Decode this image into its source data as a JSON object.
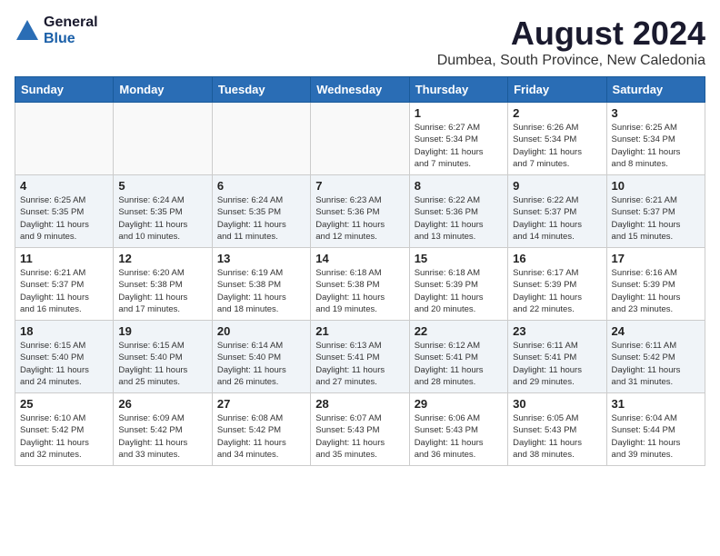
{
  "logo": {
    "general": "General",
    "blue": "Blue"
  },
  "header": {
    "month": "August 2024",
    "location": "Dumbea, South Province, New Caledonia"
  },
  "weekdays": [
    "Sunday",
    "Monday",
    "Tuesday",
    "Wednesday",
    "Thursday",
    "Friday",
    "Saturday"
  ],
  "weeks": [
    [
      {
        "day": "",
        "info": ""
      },
      {
        "day": "",
        "info": ""
      },
      {
        "day": "",
        "info": ""
      },
      {
        "day": "",
        "info": ""
      },
      {
        "day": "1",
        "info": "Sunrise: 6:27 AM\nSunset: 5:34 PM\nDaylight: 11 hours\nand 7 minutes."
      },
      {
        "day": "2",
        "info": "Sunrise: 6:26 AM\nSunset: 5:34 PM\nDaylight: 11 hours\nand 7 minutes."
      },
      {
        "day": "3",
        "info": "Sunrise: 6:25 AM\nSunset: 5:34 PM\nDaylight: 11 hours\nand 8 minutes."
      }
    ],
    [
      {
        "day": "4",
        "info": "Sunrise: 6:25 AM\nSunset: 5:35 PM\nDaylight: 11 hours\nand 9 minutes."
      },
      {
        "day": "5",
        "info": "Sunrise: 6:24 AM\nSunset: 5:35 PM\nDaylight: 11 hours\nand 10 minutes."
      },
      {
        "day": "6",
        "info": "Sunrise: 6:24 AM\nSunset: 5:35 PM\nDaylight: 11 hours\nand 11 minutes."
      },
      {
        "day": "7",
        "info": "Sunrise: 6:23 AM\nSunset: 5:36 PM\nDaylight: 11 hours\nand 12 minutes."
      },
      {
        "day": "8",
        "info": "Sunrise: 6:22 AM\nSunset: 5:36 PM\nDaylight: 11 hours\nand 13 minutes."
      },
      {
        "day": "9",
        "info": "Sunrise: 6:22 AM\nSunset: 5:37 PM\nDaylight: 11 hours\nand 14 minutes."
      },
      {
        "day": "10",
        "info": "Sunrise: 6:21 AM\nSunset: 5:37 PM\nDaylight: 11 hours\nand 15 minutes."
      }
    ],
    [
      {
        "day": "11",
        "info": "Sunrise: 6:21 AM\nSunset: 5:37 PM\nDaylight: 11 hours\nand 16 minutes."
      },
      {
        "day": "12",
        "info": "Sunrise: 6:20 AM\nSunset: 5:38 PM\nDaylight: 11 hours\nand 17 minutes."
      },
      {
        "day": "13",
        "info": "Sunrise: 6:19 AM\nSunset: 5:38 PM\nDaylight: 11 hours\nand 18 minutes."
      },
      {
        "day": "14",
        "info": "Sunrise: 6:18 AM\nSunset: 5:38 PM\nDaylight: 11 hours\nand 19 minutes."
      },
      {
        "day": "15",
        "info": "Sunrise: 6:18 AM\nSunset: 5:39 PM\nDaylight: 11 hours\nand 20 minutes."
      },
      {
        "day": "16",
        "info": "Sunrise: 6:17 AM\nSunset: 5:39 PM\nDaylight: 11 hours\nand 22 minutes."
      },
      {
        "day": "17",
        "info": "Sunrise: 6:16 AM\nSunset: 5:39 PM\nDaylight: 11 hours\nand 23 minutes."
      }
    ],
    [
      {
        "day": "18",
        "info": "Sunrise: 6:15 AM\nSunset: 5:40 PM\nDaylight: 11 hours\nand 24 minutes."
      },
      {
        "day": "19",
        "info": "Sunrise: 6:15 AM\nSunset: 5:40 PM\nDaylight: 11 hours\nand 25 minutes."
      },
      {
        "day": "20",
        "info": "Sunrise: 6:14 AM\nSunset: 5:40 PM\nDaylight: 11 hours\nand 26 minutes."
      },
      {
        "day": "21",
        "info": "Sunrise: 6:13 AM\nSunset: 5:41 PM\nDaylight: 11 hours\nand 27 minutes."
      },
      {
        "day": "22",
        "info": "Sunrise: 6:12 AM\nSunset: 5:41 PM\nDaylight: 11 hours\nand 28 minutes."
      },
      {
        "day": "23",
        "info": "Sunrise: 6:11 AM\nSunset: 5:41 PM\nDaylight: 11 hours\nand 29 minutes."
      },
      {
        "day": "24",
        "info": "Sunrise: 6:11 AM\nSunset: 5:42 PM\nDaylight: 11 hours\nand 31 minutes."
      }
    ],
    [
      {
        "day": "25",
        "info": "Sunrise: 6:10 AM\nSunset: 5:42 PM\nDaylight: 11 hours\nand 32 minutes."
      },
      {
        "day": "26",
        "info": "Sunrise: 6:09 AM\nSunset: 5:42 PM\nDaylight: 11 hours\nand 33 minutes."
      },
      {
        "day": "27",
        "info": "Sunrise: 6:08 AM\nSunset: 5:42 PM\nDaylight: 11 hours\nand 34 minutes."
      },
      {
        "day": "28",
        "info": "Sunrise: 6:07 AM\nSunset: 5:43 PM\nDaylight: 11 hours\nand 35 minutes."
      },
      {
        "day": "29",
        "info": "Sunrise: 6:06 AM\nSunset: 5:43 PM\nDaylight: 11 hours\nand 36 minutes."
      },
      {
        "day": "30",
        "info": "Sunrise: 6:05 AM\nSunset: 5:43 PM\nDaylight: 11 hours\nand 38 minutes."
      },
      {
        "day": "31",
        "info": "Sunrise: 6:04 AM\nSunset: 5:44 PM\nDaylight: 11 hours\nand 39 minutes."
      }
    ]
  ]
}
